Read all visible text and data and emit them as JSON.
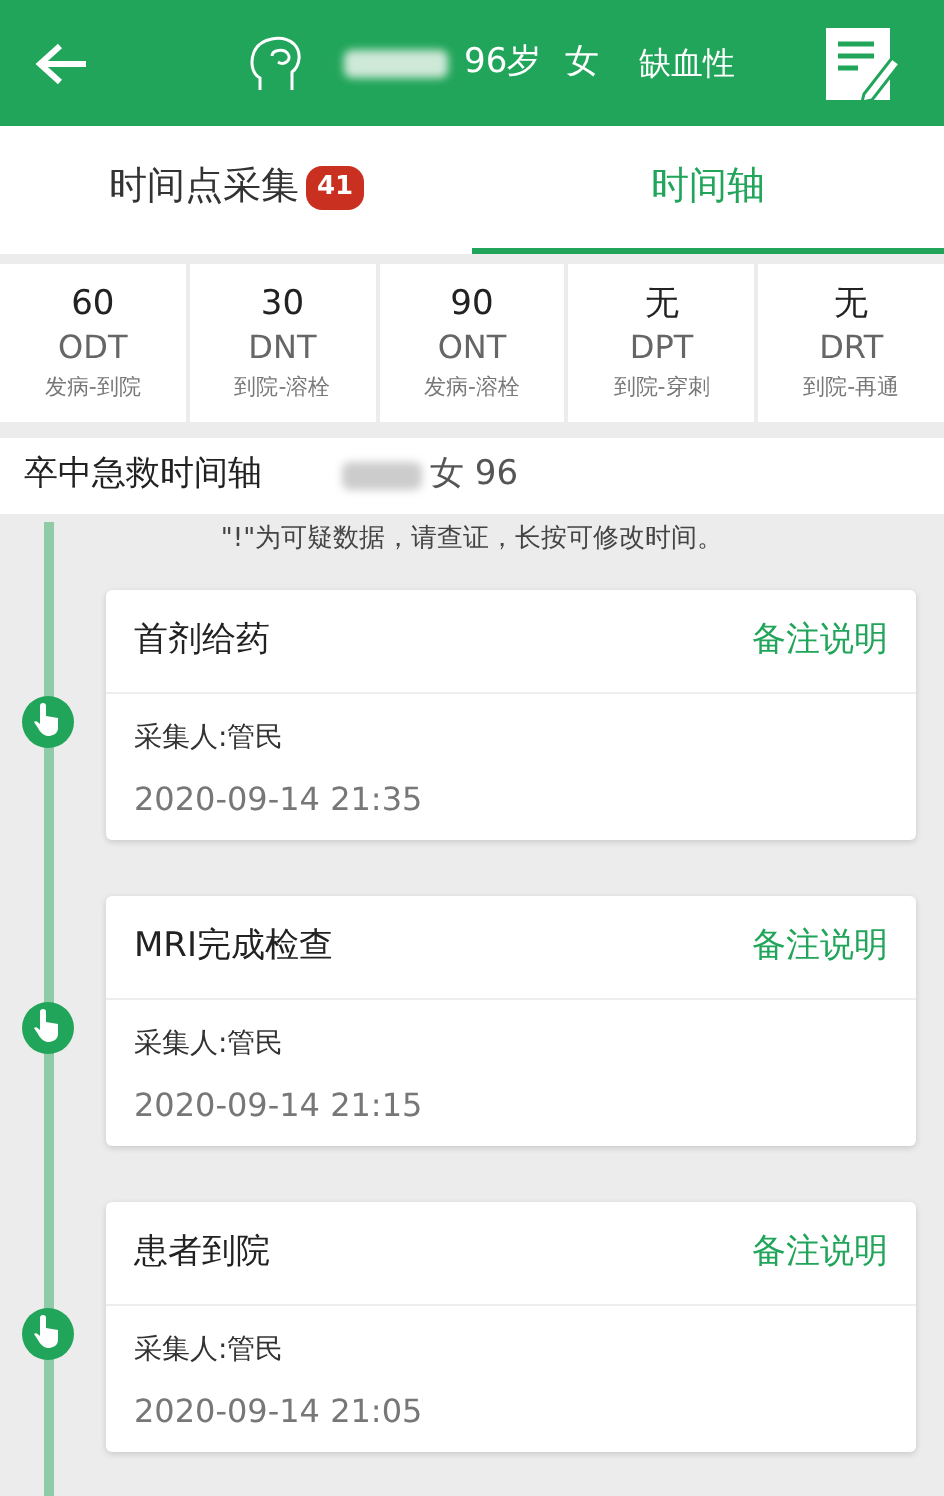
{
  "header": {
    "age": "96岁",
    "sex": "女",
    "type": "缺血性"
  },
  "tabs": [
    {
      "label": "时间点采集",
      "badge": "41",
      "selected": false
    },
    {
      "label": "时间轴",
      "selected": true
    }
  ],
  "metrics": [
    {
      "value": "60",
      "code": "ODT",
      "desc": "发病-到院"
    },
    {
      "value": "30",
      "code": "DNT",
      "desc": "到院-溶栓"
    },
    {
      "value": "90",
      "code": "ONT",
      "desc": "发病-溶栓"
    },
    {
      "value": "无",
      "code": "DPT",
      "desc": "到院-穿刺"
    },
    {
      "value": "无",
      "code": "DRT",
      "desc": "到院-再通"
    }
  ],
  "timeline": {
    "title": "卒中急救时间轴",
    "patient": "女 96",
    "note": "\"!\"为可疑数据，请查证，长按可修改时间。",
    "events": [
      {
        "name": "首剂给药",
        "remark": "备注说明",
        "collector": "采集人:管民",
        "time": "2020-09-14 21:35"
      },
      {
        "name": "MRI完成检查",
        "remark": "备注说明",
        "collector": "采集人:管民",
        "time": "2020-09-14 21:15"
      },
      {
        "name": "患者到院",
        "remark": "备注说明",
        "collector": "采集人:管民",
        "time": "2020-09-14 21:05"
      }
    ]
  }
}
